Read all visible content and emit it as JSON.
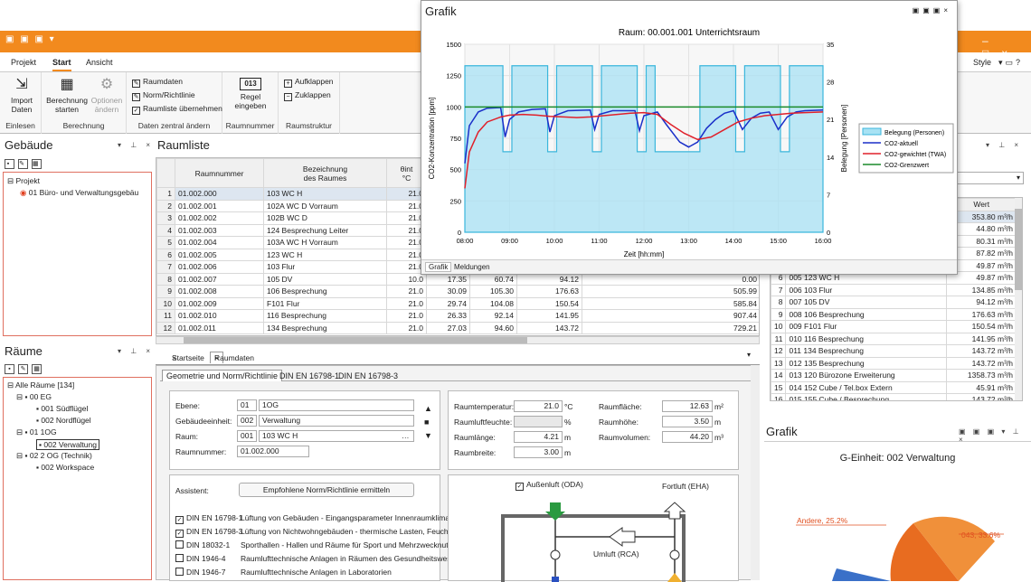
{
  "ribbon": {
    "tabs": [
      "Projekt",
      "Start",
      "Ansicht"
    ],
    "style_label": "Style",
    "groups": {
      "einlesen": {
        "label": "Einlesen",
        "import": "Import\nDaten"
      },
      "berechnung": {
        "label": "Berechnung",
        "start": "Berechnung\nstarten",
        "optionen": "Optionen\nändern"
      },
      "daten": {
        "label": "Daten zentral ändern",
        "items": [
          "Raumdaten",
          "Norm/Richtlinie",
          "Raumliste übernehmen"
        ]
      },
      "raumnummer": {
        "label": "Raumnummer",
        "regel": "Regel\neingeben",
        "icon_text": "013"
      },
      "raumstruktur": {
        "label": "Raumstruktur",
        "aufklappen": "Aufklappen",
        "zuklappen": "Zuklappen"
      }
    }
  },
  "gebaeude": {
    "title": "Gebäude",
    "items": [
      "Projekt",
      "01 Büro- und Verwaltungsgebäu"
    ]
  },
  "raeume": {
    "title": "Räume",
    "items": [
      "Alle Räume [134]",
      "00 EG",
      "001 Südflügel",
      "002 Nordflügel",
      "01 1OG",
      "002 Verwaltung",
      "02 2 OG (Technik)",
      "002 Workspace"
    ]
  },
  "raumliste": {
    "title": "Raumliste",
    "headers": [
      "Raumnummer",
      "Bezeichnung\ndes Raumes",
      "θint\n°C"
    ],
    "rows": [
      [
        "1",
        "01.002.000",
        "103 WC H",
        "21.0",
        "",
        "",
        "",
        ""
      ],
      [
        "2",
        "01.002.001",
        "102A WC D Vorraum",
        "21.0",
        "",
        "",
        "",
        ""
      ],
      [
        "3",
        "01.002.002",
        "102B WC D",
        "21.0",
        "",
        "",
        "",
        ""
      ],
      [
        "4",
        "01.002.003",
        "124 Besprechung Leiter",
        "21.0",
        "",
        "",
        "",
        ""
      ],
      [
        "5",
        "01.002.004",
        "103A WC H Vorraum",
        "21.0",
        "",
        "",
        "",
        ""
      ],
      [
        "6",
        "01.002.005",
        "123 WC H",
        "21.0",
        "",
        "",
        "",
        ""
      ],
      [
        "7",
        "01.002.006",
        "103 Flur",
        "21.0",
        "",
        "",
        "",
        ""
      ],
      [
        "8",
        "01.002.007",
        "105 DV",
        "10.0",
        "17.35",
        "60.74",
        "94.12",
        "0.00"
      ],
      [
        "9",
        "01.002.008",
        "106 Besprechung",
        "21.0",
        "30.09",
        "105.30",
        "176.63",
        "505.99"
      ],
      [
        "10",
        "01.002.009",
        "F101 Flur",
        "21.0",
        "29.74",
        "104.08",
        "150.54",
        "585.84"
      ],
      [
        "11",
        "01.002.010",
        "116 Besprechung",
        "21.0",
        "26.33",
        "92.14",
        "141.95",
        "907.44"
      ],
      [
        "12",
        "01.002.011",
        "134 Besprechung",
        "21.0",
        "27.03",
        "94.60",
        "143.72",
        "729.21"
      ]
    ]
  },
  "grafik_window": {
    "title": "Grafik",
    "chart_title": "Raum: 00.001.001 Unterrichtsraum",
    "tabs": [
      "Grafik",
      "Meldungen"
    ]
  },
  "chart_data": {
    "type": "line",
    "title": "Raum: 00.001.001 Unterrichtsraum",
    "xlabel": "Zeit [hh:mm]",
    "ylabel": "CO2-Konzentration [ppm]",
    "y2label": "Belegung [Personen]",
    "x_ticks": [
      "08:00",
      "09:00",
      "10:00",
      "11:00",
      "12:00",
      "13:00",
      "14:00",
      "15:00",
      "16:00"
    ],
    "y_ticks": [
      "0",
      "250",
      "500",
      "750",
      "1000",
      "1250",
      "1500"
    ],
    "y2_ticks": [
      "0",
      "7",
      "14",
      "21",
      "28",
      "35"
    ],
    "ylim": [
      0,
      1500
    ],
    "y2lim": [
      0,
      35
    ],
    "xlim": [
      8,
      16
    ],
    "legend_position": "right",
    "series": [
      {
        "name": "Belegung (Personen)",
        "axis": "y2",
        "color": "#3ab6dc",
        "x": [
          8.0,
          8.05,
          8.85,
          8.85,
          9.05,
          9.05,
          9.85,
          9.85,
          10.05,
          10.05,
          10.85,
          10.85,
          11.05,
          11.05,
          11.85,
          11.85,
          12.05,
          12.05,
          12.25,
          12.25,
          13.2,
          13.2,
          13.25,
          13.25,
          14.05,
          14.05,
          14.25,
          14.25,
          15.05,
          15.05,
          15.25,
          15.25,
          16.0
        ],
        "y": [
          31,
          31,
          31,
          15,
          15,
          31,
          31,
          15,
          15,
          31,
          31,
          15,
          15,
          31,
          31,
          15,
          15,
          31,
          31,
          15,
          15,
          15,
          15,
          31,
          31,
          15,
          15,
          31,
          31,
          15,
          15,
          31,
          31
        ]
      },
      {
        "name": "CO2-aktuell",
        "axis": "y",
        "color": "#1a2fc9",
        "x": [
          8.0,
          8.1,
          8.3,
          8.5,
          8.8,
          8.9,
          9.0,
          9.2,
          9.5,
          9.8,
          9.9,
          10.0,
          10.3,
          10.8,
          10.9,
          11.0,
          11.3,
          11.8,
          11.9,
          12.0,
          12.3,
          12.5,
          12.8,
          13.0,
          13.2,
          13.4,
          13.6,
          13.8,
          14.0,
          14.2,
          14.4,
          14.6,
          14.8,
          15.0,
          15.2,
          15.4,
          15.6,
          16.0
        ],
        "y": [
          550,
          850,
          960,
          990,
          995,
          760,
          900,
          960,
          980,
          985,
          800,
          930,
          970,
          975,
          820,
          940,
          970,
          970,
          810,
          930,
          960,
          860,
          720,
          680,
          720,
          830,
          900,
          950,
          970,
          820,
          910,
          950,
          960,
          820,
          920,
          960,
          970,
          975
        ]
      },
      {
        "name": "CO2-gewichtet (TWA)",
        "axis": "y",
        "color": "#e0202a",
        "x": [
          8.0,
          8.1,
          8.3,
          8.5,
          8.8,
          9.0,
          9.3,
          9.6,
          9.9,
          10.2,
          10.5,
          10.8,
          11.1,
          11.4,
          11.7,
          12.0,
          12.3,
          12.6,
          12.9,
          13.2,
          13.5,
          13.8,
          14.1,
          14.4,
          14.7,
          15.0,
          15.3,
          15.6,
          16.0
        ],
        "y": [
          350,
          640,
          800,
          880,
          920,
          935,
          940,
          935,
          925,
          920,
          915,
          920,
          930,
          940,
          950,
          955,
          940,
          860,
          790,
          740,
          760,
          820,
          880,
          910,
          930,
          940,
          950,
          955,
          960
        ]
      },
      {
        "name": "CO2-Grenzwert",
        "axis": "y",
        "color": "#1a8a2a",
        "x": [
          8.0,
          16.0
        ],
        "y": [
          1000,
          1000
        ]
      }
    ]
  },
  "rightgrid": {
    "header": "Wert",
    "top_values": [
      "353.80 m³/h",
      "44.80 m³/h",
      "80.31 m³/h",
      "87.82 m³/h",
      "49.87 m³/h"
    ],
    "rows": [
      [
        "6",
        "005 123 WC H",
        "49.87 m³/h"
      ],
      [
        "7",
        "006 103 Flur",
        "134.85 m³/h"
      ],
      [
        "8",
        "007 105 DV",
        "94.12 m³/h"
      ],
      [
        "9",
        "008 106 Besprechung",
        "176.63 m³/h"
      ],
      [
        "10",
        "009 F101 Flur",
        "150.54 m³/h"
      ],
      [
        "11",
        "010 116 Besprechung",
        "141.95 m³/h"
      ],
      [
        "12",
        "011 134 Besprechung",
        "143.72 m³/h"
      ],
      [
        "13",
        "012 135 Besprechung",
        "143.72 m³/h"
      ],
      [
        "14",
        "013 120 Bürozone Erweiterung",
        "1358.73 m³/h"
      ],
      [
        "15",
        "014 152 Cube / Tel.box Extern",
        "45.91 m³/h"
      ],
      [
        "16",
        "015 155 Cube / Besprechung",
        "143.72 m³/h"
      ]
    ]
  },
  "pie": {
    "panel_title": "Grafik",
    "title": "G-Einheit: 002 Verwaltung",
    "labels": [
      "Andere, 25.2%",
      "043, 33.6%"
    ]
  },
  "detail": {
    "tabs": [
      "Startseite",
      "Raumdaten"
    ],
    "subtabs": [
      "Geometrie und Norm/Richtlinie",
      "DIN EN 16798-1",
      "DIN EN 16798-3"
    ],
    "ebene_label": "Ebene:",
    "ebene_code": "01",
    "ebene_val": "1OG",
    "geb_label": "Gebäudeeinheit:",
    "geb_code": "002",
    "geb_val": "Verwaltung",
    "raum_label": "Raum:",
    "raum_code": "001",
    "raum_val": "103 WC H",
    "raumnr_label": "Raumnummer:",
    "raumnr_val": "01.002.000",
    "raumtemp_label": "Raumtemperatur:",
    "raumtemp_val": "21.0",
    "raumtemp_unit": "°C",
    "feuchte_label": "Raumluftfeuchte:",
    "feuchte_unit": "%",
    "laenge_label": "Raumlänge:",
    "laenge_val": "4.21",
    "laenge_unit": "m",
    "breite_label": "Raumbreite:",
    "breite_val": "3.00",
    "breite_unit": "m",
    "flaeche_label": "Raumfläche:",
    "flaeche_val": "12.63",
    "flaeche_unit": "m²",
    "hoehe_label": "Raumhöhe:",
    "hoehe_val": "3.50",
    "hoehe_unit": "m",
    "volumen_label": "Raumvolumen:",
    "volumen_val": "44.20",
    "volumen_unit": "m³",
    "assistent_label": "Assistent:",
    "assistent_btn": "Empfohlene Norm/Richtlinie ermitteln",
    "norms": [
      {
        "checked": true,
        "code": "DIN EN 16798-1",
        "text": "Lüftung von Gebäuden - Eingangsparameter Innenraumklima"
      },
      {
        "checked": true,
        "code": "DIN EN 16798-3",
        "text": "Lüftung von Nichtwohngebäuden - thermische Lasten, Feuchtelast"
      },
      {
        "checked": false,
        "code": "DIN 18032-1",
        "text": "Sporthallen - Hallen und Räume für Sport und Mehrzwecknutzung"
      },
      {
        "checked": false,
        "code": "DIN 1946-4",
        "text": "Raumlufttechnische Anlagen in Räumen des Gesundheitswesens"
      },
      {
        "checked": false,
        "code": "DIN 1946-7",
        "text": "Raumlufttechnische Anlagen in Laboratorien"
      }
    ],
    "aussenluft": "Außenluft (ODA)",
    "fortluft": "Fortluft (EHA)",
    "umluft": "Umluft (RCA)"
  }
}
